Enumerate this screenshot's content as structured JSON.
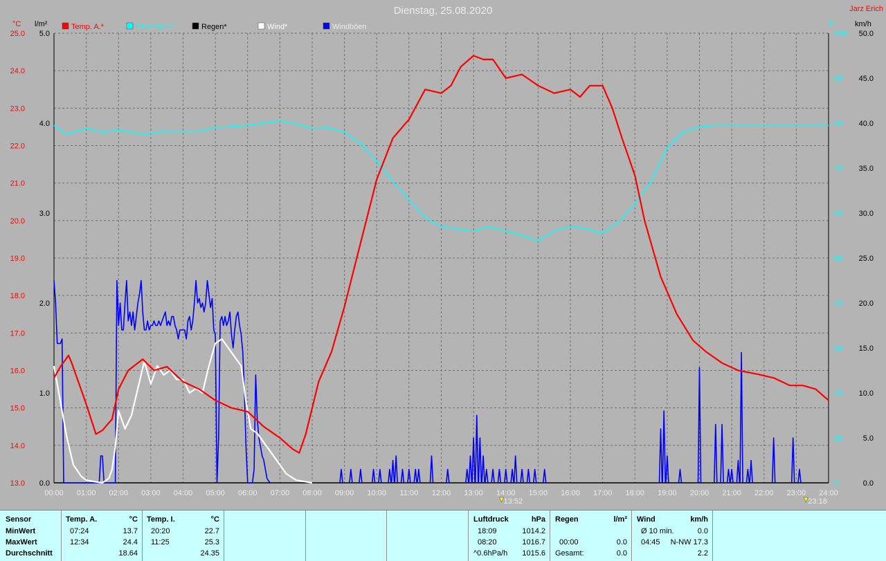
{
  "title": "Dienstag, 25.08.2020",
  "author": "Jarz Erich",
  "units": {
    "left1": "°C",
    "left2": "l/m²",
    "right1": "%",
    "right2": "km/h"
  },
  "legend": [
    {
      "label": "Temp. A.*",
      "color": "#ff0000"
    },
    {
      "label": "Feuchte A.*",
      "color": "#00ffff"
    },
    {
      "label": "Regen*",
      "color": "#000000"
    },
    {
      "label": "Wind*",
      "color": "#ffffff"
    },
    {
      "label": "Windböen",
      "color": "#0000ff"
    }
  ],
  "markers": [
    {
      "time": "13:52",
      "label": "13:52"
    },
    {
      "time": "23:18",
      "label": "23:18"
    }
  ],
  "chart_data": {
    "type": "line",
    "title": "Dienstag, 25.08.2020",
    "x_ticks": [
      "00:00",
      "01:00",
      "02:00",
      "03:00",
      "04:00",
      "05:00",
      "06:00",
      "07:00",
      "08:00",
      "09:00",
      "10:00",
      "11:00",
      "12:00",
      "13:00",
      "14:00",
      "15:00",
      "16:00",
      "17:00",
      "18:00",
      "19:00",
      "20:00",
      "21:00",
      "22:00",
      "23:00",
      "24:00"
    ],
    "y_temp": {
      "ticks": [
        "25.0",
        "24.0",
        "23.0",
        "22.0",
        "21.0",
        "20.0",
        "19.0",
        "18.0",
        "17.0",
        "16.0",
        "15.0",
        "14.0",
        "13.0"
      ],
      "range": [
        13,
        25
      ]
    },
    "y_rain": {
      "ticks": [
        "5.0",
        "4.0",
        "3.0",
        "2.0",
        "1.0",
        "0.0"
      ],
      "range": [
        0,
        5
      ]
    },
    "y_hum": {
      "ticks": [
        "100",
        "90",
        "80",
        "70",
        "60",
        "50",
        "40",
        "30",
        "20",
        "10",
        "0"
      ],
      "range": [
        0,
        100
      ]
    },
    "y_wind": {
      "ticks": [
        "50.0",
        "45.0",
        "40.0",
        "35.0",
        "30.0",
        "25.0",
        "20.0",
        "15.0",
        "10.0",
        "5.0",
        "0.0"
      ],
      "range": [
        0,
        50
      ]
    },
    "grid": true,
    "series": [
      {
        "name": "Temp. A.*",
        "axis": "temp",
        "color": "#ff0000",
        "x": [
          0,
          0.2,
          0.45,
          0.55,
          1.0,
          1.3,
          1.5,
          1.8,
          2.0,
          2.3,
          2.75,
          3.1,
          3.5,
          4.0,
          4.5,
          5.0,
          5.5,
          6.0,
          6.5,
          7.0,
          7.4,
          7.6,
          7.8,
          8.2,
          8.6,
          9.0,
          9.5,
          10.0,
          10.5,
          11.0,
          11.5,
          12.0,
          12.3,
          12.6,
          13.0,
          13.3,
          13.6,
          14.0,
          14.5,
          15.0,
          15.5,
          16.0,
          16.3,
          16.6,
          17.0,
          17.3,
          17.6,
          18.0,
          18.3,
          18.8,
          19.3,
          19.8,
          20.2,
          20.7,
          21.2,
          21.8,
          22.3,
          22.8,
          23.2,
          23.6,
          24.0
        ],
        "y": [
          15.8,
          16.1,
          16.4,
          16.2,
          15.1,
          14.3,
          14.4,
          14.7,
          15.5,
          16.0,
          16.3,
          16.0,
          16.1,
          15.7,
          15.5,
          15.2,
          15.0,
          14.9,
          14.5,
          14.2,
          13.9,
          13.8,
          14.3,
          15.7,
          16.5,
          17.7,
          19.4,
          21.1,
          22.2,
          22.7,
          23.5,
          23.4,
          23.6,
          24.1,
          24.4,
          24.3,
          24.3,
          23.8,
          23.9,
          23.6,
          23.4,
          23.5,
          23.3,
          23.6,
          23.6,
          23.0,
          22.2,
          21.2,
          20.0,
          18.5,
          17.5,
          16.8,
          16.5,
          16.2,
          16.0,
          15.9,
          15.8,
          15.6,
          15.6,
          15.5,
          15.2
        ]
      },
      {
        "name": "Feuchte A.*",
        "axis": "hum",
        "color": "#00ffff",
        "x": [
          0,
          0.4,
          1.0,
          1.5,
          2.0,
          2.8,
          3.5,
          4.5,
          5.0,
          6.0,
          7.0,
          7.5,
          8.0,
          8.5,
          9.0,
          9.5,
          10.0,
          10.5,
          11.0,
          11.5,
          12.0,
          12.5,
          13.0,
          13.5,
          14.0,
          14.5,
          15.0,
          15.5,
          16.0,
          16.5,
          17.0,
          17.5,
          18.0,
          18.5,
          19.0,
          19.5,
          20.0,
          20.5,
          21.0,
          22.0,
          23.0,
          24.0
        ],
        "y": [
          79.5,
          77.5,
          78.8,
          78.0,
          78.5,
          77.5,
          78.2,
          78.2,
          79.0,
          79.5,
          80.5,
          79.8,
          78.8,
          79.0,
          78.0,
          75.5,
          71.5,
          67.0,
          63.0,
          59.0,
          57.0,
          56.5,
          56.0,
          57.0,
          56.0,
          55.0,
          53.8,
          56.0,
          57.0,
          56.5,
          55.5,
          58.0,
          62.0,
          67.0,
          74.5,
          78.0,
          79.2,
          79.5,
          79.5,
          79.5,
          79.5,
          79.5
        ]
      },
      {
        "name": "Wind*",
        "axis": "wind",
        "color": "#ffffff",
        "x": [
          0,
          0.2,
          0.4,
          0.6,
          0.85,
          1.0,
          1.3,
          1.5,
          1.7,
          1.8,
          1.9,
          2.0,
          2.2,
          2.4,
          2.6,
          2.8,
          3.0,
          3.2,
          3.4,
          3.6,
          3.8,
          4.0,
          4.2,
          4.4,
          4.6,
          4.8,
          5.0,
          5.2,
          5.4,
          5.6,
          5.8,
          5.95,
          6.1,
          6.3,
          6.5,
          6.7,
          6.9,
          7.2,
          7.5,
          8.0
        ],
        "y": [
          13.0,
          9.0,
          5.0,
          2.0,
          0.7,
          0.3,
          0.1,
          0,
          0.5,
          1.5,
          4.0,
          8.0,
          6.0,
          7.5,
          10.5,
          13.5,
          11.0,
          13.0,
          12.0,
          12.5,
          11.5,
          11.5,
          10.0,
          10.5,
          10.0,
          13.0,
          15.5,
          16.0,
          15.0,
          14.0,
          13.0,
          9.0,
          6.0,
          5.5,
          4.5,
          3.5,
          2.5,
          1.0,
          0.3,
          0
        ]
      },
      {
        "name": "Windböen",
        "axis": "wind",
        "color": "#0000ff",
        "style": "gust",
        "x": [
          0,
          0.05,
          0.1,
          0.2,
          0.25,
          0.3,
          0.4,
          0.45,
          1.4,
          1.45,
          1.5,
          1.55,
          1.6,
          1.9,
          1.95,
          2.0,
          2.05,
          2.1,
          2.15,
          2.2,
          2.25,
          2.3,
          2.35,
          2.4,
          2.45,
          2.5,
          2.55,
          2.6,
          2.65,
          2.7,
          2.75,
          2.8,
          2.85,
          2.9,
          2.95,
          3.0,
          3.05,
          3.1,
          3.15,
          3.2,
          3.25,
          3.3,
          3.35,
          3.4,
          3.45,
          3.5,
          3.55,
          3.6,
          3.65,
          3.7,
          3.75,
          3.8,
          3.85,
          3.9,
          3.95,
          4.0,
          4.05,
          4.1,
          4.15,
          4.2,
          4.25,
          4.3,
          4.35,
          4.4,
          4.45,
          4.5,
          4.55,
          4.6,
          4.65,
          4.7,
          4.75,
          4.8,
          4.85,
          4.9,
          4.95,
          5.0,
          5.05,
          5.1,
          5.15,
          5.2,
          5.25,
          5.3,
          5.35,
          5.4,
          5.45,
          5.5,
          5.55,
          5.6,
          5.65,
          5.7,
          5.75,
          5.8,
          5.85,
          5.9,
          5.95,
          6.0,
          6.05,
          6.1,
          6.15,
          6.2,
          6.25,
          6.3,
          6.35,
          6.4,
          6.45,
          6.5,
          6.55,
          6.6,
          6.65,
          6.7
        ],
        "y": [
          22.5,
          20.0,
          15.5,
          15.5,
          16.0,
          0,
          0,
          0,
          0,
          3.0,
          3.0,
          0,
          0,
          0,
          22.5,
          17.5,
          20.0,
          17.0,
          17.0,
          20.0,
          22.5,
          18.0,
          19.0,
          17.5,
          19.0,
          17.0,
          18.5,
          20.0,
          21.0,
          22.5,
          19.0,
          17.0,
          17.0,
          18.0,
          17.0,
          17.5,
          17.5,
          18.0,
          17.5,
          17.5,
          18.0,
          17.5,
          18.0,
          18.5,
          19.0,
          17.5,
          18.0,
          17.5,
          18.5,
          18.5,
          17.5,
          17.0,
          16.0,
          17.0,
          17.0,
          17.0,
          17.0,
          16.0,
          18.0,
          18.5,
          17.0,
          18.0,
          20.0,
          22.5,
          20.0,
          20.5,
          19.5,
          20.0,
          19.0,
          20.0,
          22.5,
          21.0,
          19.5,
          20.5,
          17.0,
          16.5,
          0,
          5.0,
          18.0,
          18.5,
          17.5,
          18.5,
          17.5,
          18.0,
          19.0,
          16.5,
          15.0,
          17.0,
          18.5,
          19.0,
          17.5,
          16.5,
          14.5,
          10.0,
          4.0,
          0,
          0,
          0,
          0,
          1.5,
          12.0,
          7.0,
          5.0,
          4.0,
          3.0,
          2.5,
          1.5,
          0.5,
          0.2,
          0
        ]
      },
      {
        "name": "Regen*",
        "axis": "rain",
        "color": "#000000",
        "x": [
          0,
          24
        ],
        "y": [
          0,
          0
        ]
      }
    ],
    "gust_spikes": [
      [
        8.9,
        1.5
      ],
      [
        9.2,
        1.5
      ],
      [
        9.5,
        1.5
      ],
      [
        9.9,
        1.5
      ],
      [
        10.1,
        1.5
      ],
      [
        10.4,
        1.5
      ],
      [
        10.5,
        2.5
      ],
      [
        10.6,
        3.0
      ],
      [
        10.8,
        1.5
      ],
      [
        11.0,
        1.5
      ],
      [
        11.2,
        1.5
      ],
      [
        11.3,
        1.5
      ],
      [
        11.7,
        3.0
      ],
      [
        12.2,
        1.5
      ],
      [
        12.8,
        1.5
      ],
      [
        12.9,
        3.0
      ],
      [
        13.0,
        5.0
      ],
      [
        13.1,
        7.5
      ],
      [
        13.2,
        5.0
      ],
      [
        13.3,
        3.0
      ],
      [
        13.4,
        1.5
      ],
      [
        13.6,
        1.5
      ],
      [
        13.8,
        1.5
      ],
      [
        14.0,
        1.5
      ],
      [
        14.2,
        1.5
      ],
      [
        14.3,
        3.0
      ],
      [
        14.5,
        1.5
      ],
      [
        14.7,
        1.5
      ],
      [
        14.9,
        1.5
      ],
      [
        15.2,
        1.5
      ],
      [
        18.8,
        6.0
      ],
      [
        18.9,
        8.0
      ],
      [
        19.0,
        3.0
      ],
      [
        19.4,
        1.5
      ],
      [
        20.0,
        12.8
      ],
      [
        20.5,
        6.5
      ],
      [
        20.7,
        6.5
      ],
      [
        20.9,
        1.5
      ],
      [
        21.0,
        1.5
      ],
      [
        21.2,
        2.5
      ],
      [
        21.3,
        14.5
      ],
      [
        21.5,
        1.5
      ],
      [
        21.6,
        2.5
      ],
      [
        22.3,
        5.0
      ],
      [
        22.9,
        5.0
      ],
      [
        23.1,
        1.5
      ]
    ]
  },
  "stats": {
    "sensor": {
      "header": "Sensor",
      "rows": [
        "MinWert",
        "MaxWert",
        "Durchschnitt"
      ]
    },
    "temp_a": {
      "header": "Temp. A.",
      "unit": "°C",
      "min_time": "07:24",
      "min_val": "13.7",
      "max_time": "12:34",
      "max_val": "24.4",
      "avg": "18.64"
    },
    "temp_i": {
      "header": "Temp. I.",
      "unit": "°C",
      "min_time": "20:20",
      "min_val": "22.7",
      "max_time": "11:25",
      "max_val": "25.3",
      "avg": "24.35"
    },
    "pressure": {
      "header": "Luftdruck",
      "unit": "hPa",
      "min_time": "18:09",
      "min_val": "1014.2",
      "max_time": "08:20",
      "max_val": "1016.7",
      "trend_label": "^0.6hPa/h",
      "trend_val": "1015.6"
    },
    "rain": {
      "header": "Regen",
      "unit": "l/m²",
      "max_time": "00:00",
      "max_val": "0.0",
      "total_label": "Gesamt:",
      "total_val": "0.0"
    },
    "wind": {
      "header": "Wind",
      "unit": "km/h",
      "avg_label": "Ø 10 min.",
      "avg_val": "0.0",
      "max_time": "04:45",
      "max_val": "N-NW 17.3",
      "day_avg": "2.2"
    }
  }
}
